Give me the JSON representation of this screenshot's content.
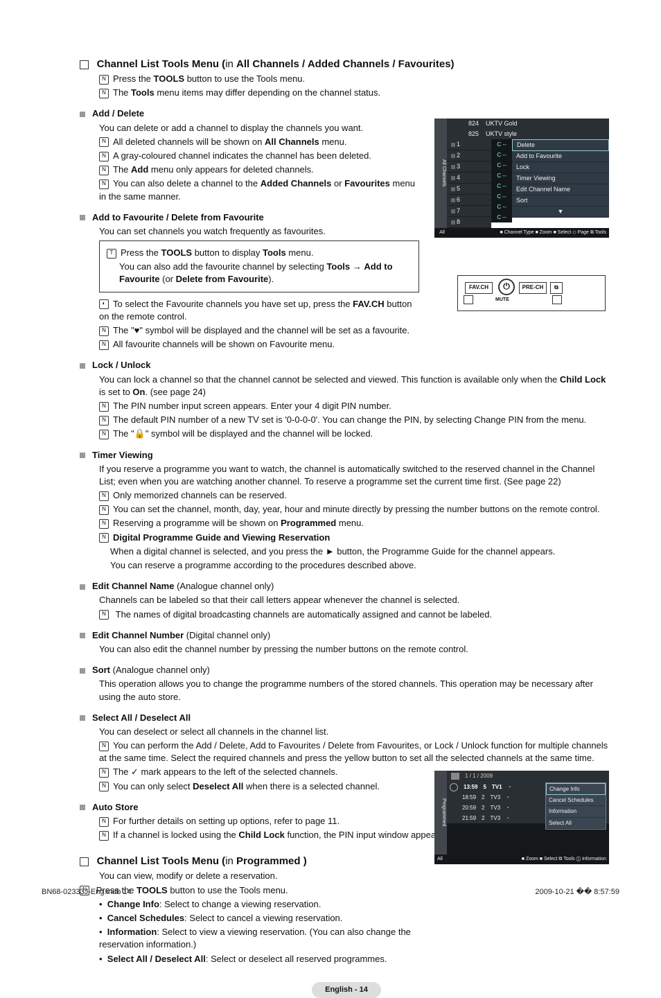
{
  "section1": {
    "title_prefix": "Channel List Tools Menu (",
    "title_in": "in ",
    "title_scope": "All Channels / Added Channels / Favourites)",
    "line1_pre": "Press the ",
    "line1_bold": "TOOLS",
    "line1_post": " button to use the Tools menu.",
    "line2_pre": "The ",
    "line2_bold": "Tools",
    "line2_post": " menu  items may differ depending on the channel status."
  },
  "adddelete": {
    "title": "Add / Delete",
    "p1": "You can delete or add a channel to display the channels you want.",
    "n1_pre": "All deleted channels will be shown on ",
    "n1_bold": "All Channels",
    "n1_post": " menu.",
    "n2": "A gray-coloured channel indicates the channel has been deleted.",
    "n3_pre": "The ",
    "n3_bold": "Add",
    "n3_post": " menu only appears for deleted channels.",
    "n4_pre": "You can also delete a channel to the ",
    "n4_b1": "Added Channels",
    "n4_mid": " or ",
    "n4_b2": "Favourites",
    "n4_post": " menu in the same manner."
  },
  "fav": {
    "title": "Add to Favourite / Delete from Favourite",
    "p1": "You can set channels you watch frequently as favourites.",
    "box1_pre": "Press the ",
    "box1_b1": "TOOLS",
    "box1_mid": " button to display ",
    "box1_b2": "Tools",
    "box1_post": " menu.",
    "box2_pre": "You can also add the favourite channel by selecting ",
    "box2_b1": "Tools",
    "box2_arrow": " → ",
    "box2_b2": "Add to Favourite",
    "box2_post2_pre": " (or ",
    "box2_b3": "Delete from Favourite",
    "box2_post2_post": ").",
    "r1_pre": "To select the Favourite channels you have set up, press the ",
    "r1_bold": "FAV.CH",
    "r1_post": " button on the remote control.",
    "n1": "The \"♥\" symbol will be displayed and the channel will be set as a favourite.",
    "n2": "All favourite channels will be shown on Favourite menu."
  },
  "lock": {
    "title": "Lock / Unlock",
    "p1_pre": "You can lock a channel so that the channel cannot be selected and viewed. This function is available only when the ",
    "p1_bold": "Child Lock",
    "p1_mid": " is set to ",
    "p1_bold2": "On",
    "p1_post": ". (see page 24)",
    "n1": "The PIN number input screen appears. Enter your 4 digit PIN number.",
    "n2": "The default PIN number of a new TV set is '0-0-0-0'. You can change the PIN, by selecting Change PIN from the menu.",
    "n3": "The \"🔒\" symbol will be displayed and the channel will be locked."
  },
  "timer": {
    "title": "Timer Viewing",
    "p1": "If you reserve a programme you want to watch, the channel is automatically switched to the reserved channel in the Channel List; even when you are watching another channel. To reserve a programme set the current time first. (See page 22)",
    "n1": "Only memorized channels can be reserved.",
    "n2": "You can set the channel, month, day, year, hour and minute directly by pressing the number buttons on the remote control.",
    "n3_pre": "Reserving a programme will be shown on ",
    "n3_bold": "Programmed",
    "n3_post": " menu.",
    "n4_bold": "Digital Programme Guide and Viewing Reservation",
    "n4_l1": "When a digital channel is selected, and you press the ► button, the Programme Guide for the channel appears.",
    "n4_l2": "You can reserve a programme  according to the procedures described above."
  },
  "editname": {
    "title_bold": "Edit Channel Name",
    "title_post": " (Analogue channel only)",
    "p1": "Channels can be labeled so that their call letters appear whenever the channel is selected.",
    "n1": "The names of digital broadcasting channels are automatically assigned and cannot be labeled."
  },
  "editnum": {
    "title_bold": "Edit Channel Number",
    "title_post": " (Digital channel only)",
    "p1": "You can also edit the channel number by pressing the number buttons on the remote control."
  },
  "sort": {
    "title_bold": "Sort",
    "title_post": " (Analogue channel only)",
    "p1": "This operation allows you to change the programme numbers of the stored channels. This operation may be necessary after using the auto store."
  },
  "select": {
    "title": "Select All / Deselect All",
    "p1": "You can deselect or select all channels in the channel list.",
    "n1": "You can perform the Add / Delete, Add to Favourites / Delete from Favourites, or Lock / Unlock function for multiple channels at the same time. Select the required channels and press the yellow button to set all the selected channels at the same time.",
    "n2": "The ✓ mark appears to the left of the selected channels.",
    "n3_pre": "You can only select ",
    "n3_bold": "Deselect All",
    "n3_post": " when there is a selected channel."
  },
  "auto": {
    "title": "Auto Store",
    "n1": "For further details on setting up options, refer to page 11.",
    "n2_pre": "If a channel is locked using the ",
    "n2_bold": "Child Lock",
    "n2_post": " function, the PIN input window appears."
  },
  "section2": {
    "title_prefix": "Channel List Tools Menu (",
    "title_in": "in ",
    "title_scope": "Programmed )",
    "p1": "You can view, modify or delete a reservation.",
    "n1_pre": "Press the ",
    "n1_bold": "TOOLS",
    "n1_post": " button to use the Tools menu.",
    "b1_bold": "Change Info",
    "b1_post": ": Select to change a viewing reservation.",
    "b2_bold": "Cancel Schedules",
    "b2_post": ": Select to cancel a viewing reservation.",
    "b3_bold": "Information",
    "b3_post": ": Select to view a viewing reservation. (You can also change the reservation information.)",
    "b4_bold": "Select All / Deselect All",
    "b4_post": ": Select or deselect all reserved programmes."
  },
  "pagebadge": "English - 14",
  "footer_left": "BN68-02333J-Eng.indb   14",
  "footer_right": "2009-10-21   �� 8:57:59",
  "osd1": {
    "sidebar": "All Channels",
    "toprows": [
      {
        "num": "824",
        "name": "UKTV Gold"
      },
      {
        "num": "825",
        "name": "UKTV style"
      }
    ],
    "rows": [
      {
        "idx": "1",
        "c": "C --"
      },
      {
        "idx": "2",
        "c": "C --"
      },
      {
        "idx": "3",
        "c": "C --"
      },
      {
        "idx": "4",
        "c": "C --"
      },
      {
        "idx": "5",
        "c": "C --"
      },
      {
        "idx": "6",
        "c": "C --"
      },
      {
        "idx": "7",
        "c": "C --"
      },
      {
        "idx": "8",
        "c": "C --"
      }
    ],
    "popup": [
      "Delete",
      "Add to Favourite",
      "Lock",
      "Timer Viewing",
      "Edit Channel Name",
      "Sort"
    ],
    "footer_all": "All",
    "footer_legend": "■ Channel Type  ■ Zoom  ■ Select  ◇ Page  ⧉ Tools"
  },
  "remote": {
    "fav": "FAV.CH",
    "pre": "PRE-CH"
  },
  "osd2": {
    "sidebar": "Programmed",
    "date": "1 / 1 / 2009",
    "rows": [
      {
        "t": "13:59",
        "a": "5",
        "ch": "TV1",
        "sel": true
      },
      {
        "t": "18:59",
        "a": "2",
        "ch": "TV3"
      },
      {
        "t": "20:59",
        "a": "2",
        "ch": "TV3"
      },
      {
        "t": "21:59",
        "a": "2",
        "ch": "TV3"
      }
    ],
    "popup": [
      "Change Info",
      "Cancel Schedules",
      "Information",
      "Select All"
    ],
    "footer_all": "All",
    "footer_legend": "■ Zoom  ■ Select  ⧉ Tools  ⓘ Information"
  }
}
